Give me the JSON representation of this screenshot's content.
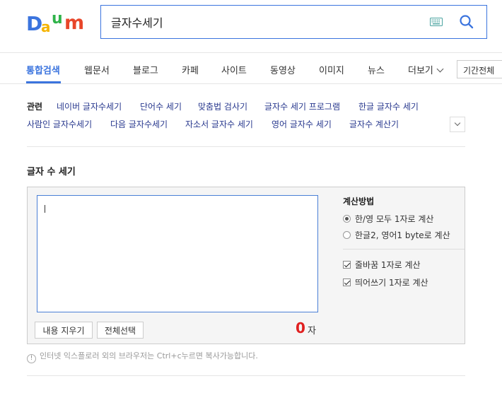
{
  "logo": {
    "letters": [
      "D",
      "a",
      "u",
      "m"
    ],
    "colors": [
      "#3b74de",
      "#f5b400",
      "#2fb34a",
      "#e8462a"
    ]
  },
  "search": {
    "query": "글자수세기",
    "keyboard_icon": "keyboard-icon",
    "search_icon": "search-icon"
  },
  "tabs": [
    {
      "label": "통합검색",
      "active": true
    },
    {
      "label": "웹문서"
    },
    {
      "label": "블로그"
    },
    {
      "label": "카페"
    },
    {
      "label": "사이트"
    },
    {
      "label": "동영상"
    },
    {
      "label": "이미지"
    },
    {
      "label": "뉴스"
    },
    {
      "label": "더보기"
    }
  ],
  "period_filter": "기간전체",
  "related": {
    "title": "관련",
    "links": [
      "네이버 글자수세기",
      "단어수 세기",
      "맞춤법 검사기",
      "글자수 세기 프로그램",
      "한글 글자수 세기",
      "사람인 글자수세기",
      "다음 글자수세기",
      "자소서 글자수 세기",
      "영어 글자수 세기",
      "글자수 계산기"
    ]
  },
  "counter": {
    "title": "글자 수 세기",
    "text_value": "",
    "clear_button": "내용 지우기",
    "select_all_button": "전체선택",
    "count": "0",
    "unit": "자",
    "method_title": "계산방법",
    "methods": [
      {
        "label": "한/영 모두 1자로 계산",
        "selected": true
      },
      {
        "label": "한글2, 영어1 byte로 계산",
        "selected": false
      }
    ],
    "options": [
      {
        "label": "줄바꿈 1자로 계산",
        "checked": true
      },
      {
        "label": "띄어쓰기 1자로 계산",
        "checked": true
      }
    ],
    "notice": "인터넷 익스플로러 외의 브라우저는 Ctrl+c누르면 복사가능합니다."
  },
  "colors": {
    "accent": "#3b74de",
    "count_red": "#e02020"
  }
}
